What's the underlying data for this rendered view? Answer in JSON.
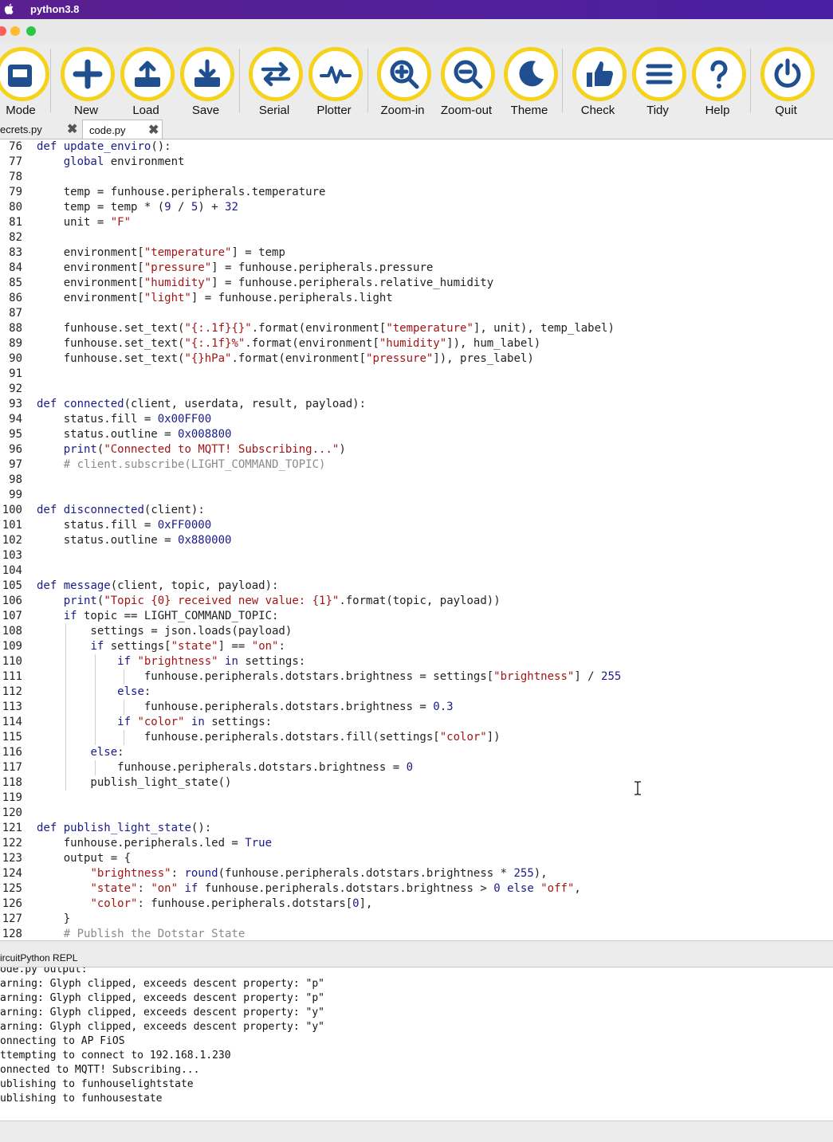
{
  "menubar": {
    "app_name": "python3.8"
  },
  "toolbar": {
    "buttons": [
      {
        "label": "Mode",
        "icon": "mode-icon"
      },
      {
        "label": "New",
        "icon": "plus-icon"
      },
      {
        "label": "Load",
        "icon": "upload-icon"
      },
      {
        "label": "Save",
        "icon": "download-icon"
      },
      {
        "label": "Serial",
        "icon": "serial-arrows-icon"
      },
      {
        "label": "Plotter",
        "icon": "pulse-icon"
      },
      {
        "label": "Zoom-in",
        "icon": "zoom-in-icon"
      },
      {
        "label": "Zoom-out",
        "icon": "zoom-out-icon"
      },
      {
        "label": "Theme",
        "icon": "moon-icon"
      },
      {
        "label": "Check",
        "icon": "thumbs-up-icon"
      },
      {
        "label": "Tidy",
        "icon": "lines-icon"
      },
      {
        "label": "Help",
        "icon": "question-icon"
      },
      {
        "label": "Quit",
        "icon": "power-icon"
      }
    ]
  },
  "tabs": [
    {
      "label": "ecrets.py",
      "close": "✖"
    },
    {
      "label": "code.py",
      "close": "✖",
      "active": true
    }
  ],
  "editor": {
    "lines": [
      {
        "n": "76",
        "html": "<span class=\"kw\">def</span> <span class=\"fn\">update_enviro</span>():"
      },
      {
        "n": "77",
        "html": "    <span class=\"kw\">global</span> environment"
      },
      {
        "n": "78",
        "html": ""
      },
      {
        "n": "79",
        "html": "    temp = funhouse.peripherals.temperature"
      },
      {
        "n": "80",
        "html": "    temp = temp * (<span class=\"nm\">9</span> / <span class=\"nm\">5</span>) + <span class=\"nm\">32</span>"
      },
      {
        "n": "81",
        "html": "    unit = <span class=\"st\">\"F\"</span>"
      },
      {
        "n": "82",
        "html": ""
      },
      {
        "n": "83",
        "html": "    environment[<span class=\"st\">\"temperature\"</span>] = temp"
      },
      {
        "n": "84",
        "html": "    environment[<span class=\"st\">\"pressure\"</span>] = funhouse.peripherals.pressure"
      },
      {
        "n": "85",
        "html": "    environment[<span class=\"st\">\"humidity\"</span>] = funhouse.peripherals.relative_humidity"
      },
      {
        "n": "86",
        "html": "    environment[<span class=\"st\">\"light\"</span>] = funhouse.peripherals.light"
      },
      {
        "n": "87",
        "html": ""
      },
      {
        "n": "88",
        "html": "    funhouse.set_text(<span class=\"st\">\"{:.1f}{}\"</span>.format(environment[<span class=\"st\">\"temperature\"</span>], unit), temp_label)"
      },
      {
        "n": "89",
        "html": "    funhouse.set_text(<span class=\"st\">\"{:.1f}%\"</span>.format(environment[<span class=\"st\">\"humidity\"</span>]), hum_label)"
      },
      {
        "n": "90",
        "html": "    funhouse.set_text(<span class=\"st\">\"{}hPa\"</span>.format(environment[<span class=\"st\">\"pressure\"</span>]), pres_label)"
      },
      {
        "n": "91",
        "html": ""
      },
      {
        "n": "92",
        "html": ""
      },
      {
        "n": "93",
        "html": "<span class=\"kw\">def</span> <span class=\"fn\">connected</span>(client, userdata, result, payload):"
      },
      {
        "n": "94",
        "html": "    status.fill = <span class=\"nm\">0x00FF00</span>"
      },
      {
        "n": "95",
        "html": "    status.outline = <span class=\"nm\">0x008800</span>"
      },
      {
        "n": "96",
        "html": "    <span class=\"kw\">print</span>(<span class=\"st\">\"Connected to MQTT! Subscribing...\"</span>)"
      },
      {
        "n": "97",
        "html": "    <span class=\"cm\"># client.subscribe(LIGHT_COMMAND_TOPIC)</span>"
      },
      {
        "n": "98",
        "html": ""
      },
      {
        "n": "99",
        "html": ""
      },
      {
        "n": "100",
        "html": "<span class=\"kw\">def</span> <span class=\"fn\">disconnected</span>(client):"
      },
      {
        "n": "101",
        "html": "    status.fill = <span class=\"nm\">0xFF0000</span>"
      },
      {
        "n": "102",
        "html": "    status.outline = <span class=\"nm\">0x880000</span>"
      },
      {
        "n": "103",
        "html": ""
      },
      {
        "n": "104",
        "html": ""
      },
      {
        "n": "105",
        "html": "<span class=\"kw\">def</span> <span class=\"fn\">message</span>(client, topic, payload):"
      },
      {
        "n": "106",
        "html": "    <span class=\"kw\">print</span>(<span class=\"st\">\"Topic {0} received new value: {1}\"</span>.format(topic, payload))"
      },
      {
        "n": "107",
        "html": "    <span class=\"kw\">if</span> topic == LIGHT_COMMAND_TOPIC:"
      },
      {
        "n": "108",
        "html": "        settings = json.loads(payload)",
        "guides": [
          1
        ]
      },
      {
        "n": "109",
        "html": "        <span class=\"kw\">if</span> settings[<span class=\"st\">\"state\"</span>] == <span class=\"st\">\"on\"</span>:",
        "guides": [
          1
        ]
      },
      {
        "n": "110",
        "html": "            <span class=\"kw\">if</span> <span class=\"st\">\"brightness\"</span> <span class=\"kw\">in</span> settings:",
        "guides": [
          1,
          2
        ]
      },
      {
        "n": "111",
        "html": "                funhouse.peripherals.dotstars.brightness = settings[<span class=\"st\">\"brightness\"</span>] / <span class=\"nm\">255</span>",
        "guides": [
          1,
          2,
          3
        ]
      },
      {
        "n": "112",
        "html": "            <span class=\"kw\">else</span>:",
        "guides": [
          1,
          2
        ]
      },
      {
        "n": "113",
        "html": "                funhouse.peripherals.dotstars.brightness = <span class=\"nm\">0.3</span>",
        "guides": [
          1,
          2,
          3
        ]
      },
      {
        "n": "114",
        "html": "            <span class=\"kw\">if</span> <span class=\"st\">\"color\"</span> <span class=\"kw\">in</span> settings:",
        "guides": [
          1,
          2
        ]
      },
      {
        "n": "115",
        "html": "                funhouse.peripherals.dotstars.fill(settings[<span class=\"st\">\"color\"</span>])",
        "guides": [
          1,
          2,
          3
        ]
      },
      {
        "n": "116",
        "html": "        <span class=\"kw\">else</span>:",
        "guides": [
          1
        ]
      },
      {
        "n": "117",
        "html": "            funhouse.peripherals.dotstars.brightness = <span class=\"nm\">0</span>",
        "guides": [
          1,
          2
        ]
      },
      {
        "n": "118",
        "html": "        publish_light_state()",
        "guides": [
          1
        ]
      },
      {
        "n": "119",
        "html": ""
      },
      {
        "n": "120",
        "html": ""
      },
      {
        "n": "121",
        "html": "<span class=\"kw\">def</span> <span class=\"fn\">publish_light_state</span>():"
      },
      {
        "n": "122",
        "html": "    funhouse.peripherals.led = <span class=\"kw\">True</span>"
      },
      {
        "n": "123",
        "html": "    output = {"
      },
      {
        "n": "124",
        "html": "        <span class=\"st\">\"brightness\"</span>: <span class=\"kw\">round</span>(funhouse.peripherals.dotstars.brightness * <span class=\"nm\">255</span>),"
      },
      {
        "n": "125",
        "html": "        <span class=\"st\">\"state\"</span>: <span class=\"st\">\"on\"</span> <span class=\"kw\">if</span> funhouse.peripherals.dotstars.brightness &gt; <span class=\"nm\">0</span> <span class=\"kw\">else</span> <span class=\"st\">\"off\"</span>,"
      },
      {
        "n": "126",
        "html": "        <span class=\"st\">\"color\"</span>: funhouse.peripherals.dotstars[<span class=\"nm\">0</span>],"
      },
      {
        "n": "127",
        "html": "    }"
      },
      {
        "n": "128",
        "html": "    <span class=\"cm\"># Publish the Dotstar State</span>"
      }
    ]
  },
  "repl": {
    "title": "ircuitPython REPL",
    "lines": [
      "ode.py output:",
      "arning: Glyph clipped, exceeds descent property: \"p\"",
      "arning: Glyph clipped, exceeds descent property: \"p\"",
      "arning: Glyph clipped, exceeds descent property: \"y\"",
      "arning: Glyph clipped, exceeds descent property: \"y\"",
      "onnecting to AP FiOS",
      "ttempting to connect to 192.168.1.230",
      "onnected to MQTT! Subscribing...",
      "ublishing to funhouselightstate",
      "ublishing to funhousestate"
    ]
  },
  "colors": {
    "accent": "#f5d21c",
    "menubar": "#4a1fa3",
    "keyword": "#1a1a8a",
    "string": "#a31515",
    "comment": "#8a8a8a"
  }
}
